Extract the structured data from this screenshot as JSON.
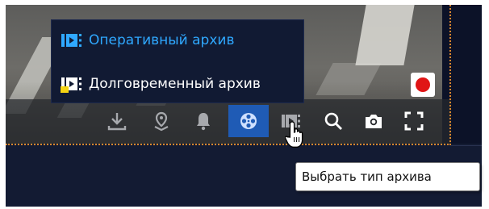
{
  "archive_menu": {
    "items": [
      {
        "label": "Оперативный архив",
        "icon": "archive-film-icon",
        "color": "#2fa8ff"
      },
      {
        "label": "Долговременный архив",
        "icon": "archive-film-lock-icon",
        "color": "#ffffff"
      }
    ]
  },
  "toolbar": {
    "buttons": [
      {
        "icon": "download-icon"
      },
      {
        "icon": "map-pin-icon"
      },
      {
        "icon": "bell-icon"
      },
      {
        "icon": "film-reel-icon",
        "active": true
      },
      {
        "icon": "archive-type-icon"
      },
      {
        "icon": "search-icon"
      },
      {
        "icon": "camera-icon"
      },
      {
        "icon": "fullscreen-icon"
      }
    ]
  },
  "record_button": {
    "icon": "record-icon",
    "color": "#e01515"
  },
  "tooltip": {
    "text": "Выбрать тип архива"
  },
  "colors": {
    "accent": "#1f5bb5",
    "selection_border": "#d9872e",
    "background": "#131b33"
  }
}
